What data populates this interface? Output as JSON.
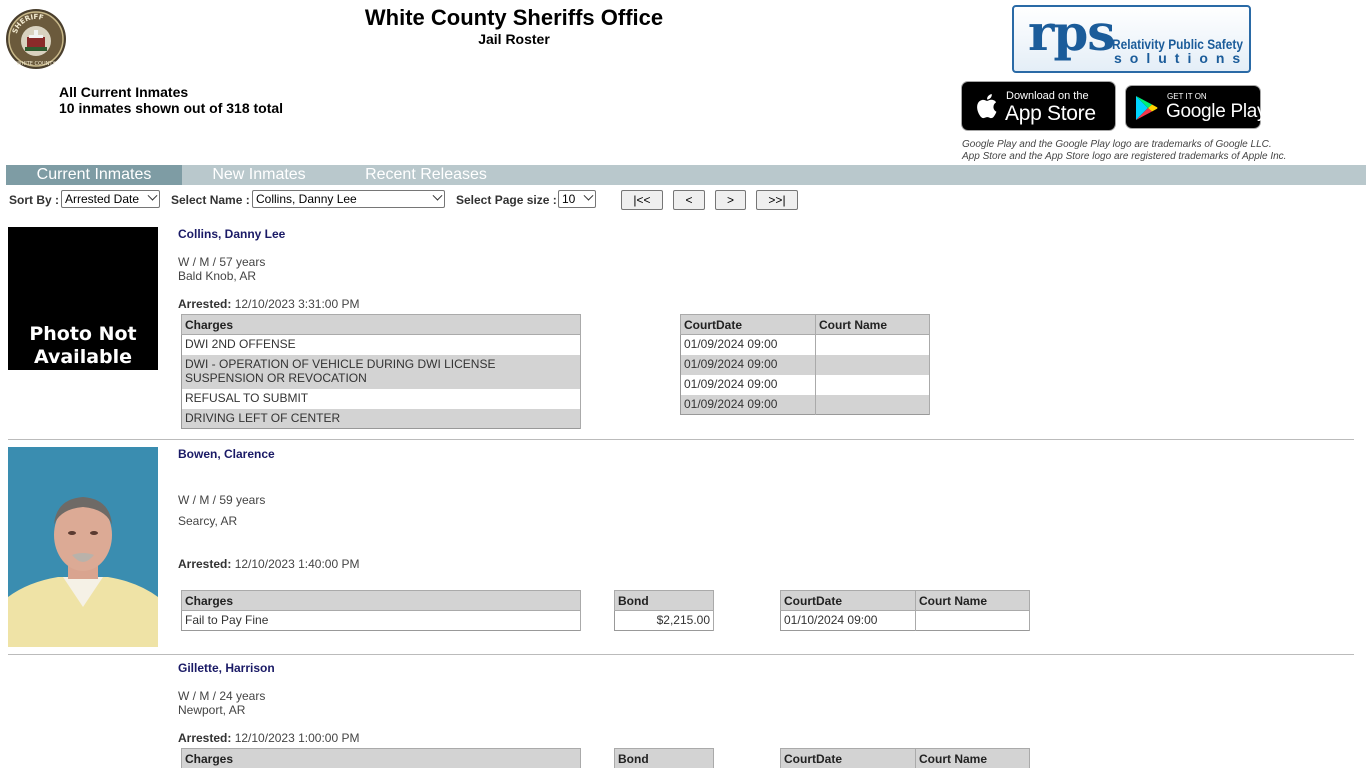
{
  "header": {
    "title": "White County Sheriffs Office",
    "subtitle": "Jail Roster",
    "summary_line1": "All Current Inmates",
    "summary_line2": "10 inmates shown out of 318 total"
  },
  "badge": {
    "text_top": "SHERIFF",
    "text_side": "WHITE COUNTY"
  },
  "rps_logo": {
    "mark": "rps",
    "line1": "Relativity Public Safety",
    "line2": "solutions"
  },
  "app_store": {
    "small": "Download on the",
    "big": "App Store"
  },
  "google_play": {
    "small": "GET IT ON",
    "big": "Google Play"
  },
  "trademark": {
    "line1": "Google Play and the Google Play logo are trademarks of Google LLC.",
    "line2": "App Store and the App Store logo are registered trademarks of Apple Inc."
  },
  "tabs": [
    {
      "label": "Current Inmates",
      "active": true
    },
    {
      "label": "New Inmates",
      "active": false
    },
    {
      "label": "Recent Releases",
      "active": false
    }
  ],
  "controls": {
    "sort_label": "Sort By :",
    "sort_value": "Arrested Date",
    "name_label": "Select Name :",
    "name_value": "Collins, Danny Lee",
    "pagesize_label": "Select Page size :",
    "pagesize_value": "10",
    "first": "|<<",
    "prev": "<",
    "next": ">",
    "last": ">>|"
  },
  "inmates": [
    {
      "name": "Collins, Danny Lee",
      "demographics": "W / M / 57 years",
      "location": "Bald Knob, AR",
      "arrested_label": "Arrested:",
      "arrested": "12/10/2023 3:31:00 PM",
      "photo_text_1": "Photo Not",
      "photo_text_2": "Available",
      "charges_header": "Charges",
      "charges": [
        "DWI 2ND OFFENSE",
        "DWI - OPERATION OF VEHICLE DURING DWI LICENSE SUSPENSION OR REVOCATION",
        "REFUSAL TO SUBMIT",
        "DRIVING LEFT OF CENTER"
      ],
      "court_headers": [
        "CourtDate",
        "Court Name"
      ],
      "court_dates": [
        "01/09/2024 09:00",
        "01/09/2024 09:00",
        "01/09/2024 09:00",
        "01/09/2024 09:00"
      ]
    },
    {
      "name": "Bowen, Clarence",
      "demographics": "W / M / 59 years",
      "location": "Searcy, AR",
      "arrested_label": "Arrested:",
      "arrested": "12/10/2023 1:40:00 PM",
      "charges_header": "Charges",
      "charges": [
        "Fail to Pay Fine"
      ],
      "bond_header": "Bond",
      "bonds": [
        "$2,215.00"
      ],
      "court_headers": [
        "CourtDate",
        "Court Name"
      ],
      "court_dates": [
        "01/10/2024 09:00"
      ]
    },
    {
      "name": "Gillette, Harrison",
      "demographics": "W / M / 24 years",
      "location": "Newport, AR",
      "arrested_label": "Arrested:",
      "arrested": "12/10/2023 1:00:00 PM",
      "charges_header": "Charges",
      "bond_header": "Bond",
      "court_headers": [
        "CourtDate",
        "Court Name"
      ]
    }
  ],
  "colors": {
    "tab_bar": "#b9c8cc",
    "tab_active": "#7e9ca4",
    "name_text": "#1a1a66",
    "table_header": "#d3d3d3",
    "rps_blue": "#1b5c9a"
  }
}
